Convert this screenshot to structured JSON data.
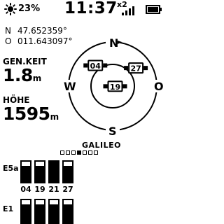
{
  "status": {
    "brightness_icon": "sun-icon",
    "battery_percent": "23%",
    "time": "11:37",
    "satellite_count": "x2",
    "signal_icon": "signal-bars-icon",
    "battery_icon": "battery-icon"
  },
  "position": {
    "lat_label": "N",
    "lat_value": "47.652359°",
    "lon_label": "O",
    "lon_value": "011.643097°"
  },
  "speed": {
    "label": "GEN.KEIT",
    "value": "1.8",
    "unit": "m"
  },
  "altitude": {
    "label": "HÖHE",
    "value": "1595",
    "unit": "m"
  },
  "sky": {
    "north": "N",
    "east": "O",
    "south": "S",
    "west": "W",
    "satellites": [
      {
        "prn": "04",
        "azimuth_deg": 320,
        "elevation_deg": 35
      },
      {
        "prn": "27",
        "azimuth_deg": 52,
        "elevation_deg": 30
      },
      {
        "prn": "19",
        "azimuth_deg": 95,
        "elevation_deg": 85
      }
    ]
  },
  "galileo": {
    "name": "GALILEO",
    "pages": [
      false,
      false,
      false,
      true,
      false,
      false,
      false
    ],
    "bands": [
      {
        "label": "E5a",
        "signal_fraction": [
          0.8,
          0.8,
          1.0,
          0.8
        ]
      },
      {
        "label": "E1",
        "signal_fraction": [
          0.8,
          0.8,
          0.8,
          0.8
        ]
      }
    ],
    "prns": [
      "04",
      "19",
      "21",
      "27"
    ]
  }
}
